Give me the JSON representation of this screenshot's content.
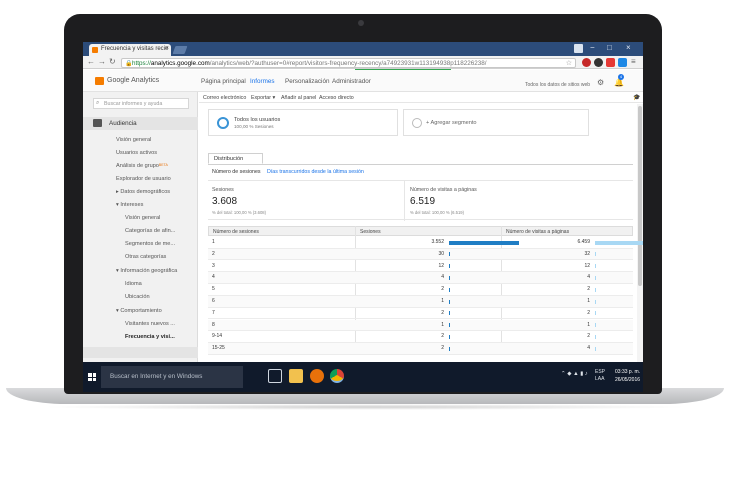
{
  "browser": {
    "tab_title": "Frecuencia y visitas recie",
    "tab_close": "×",
    "url_prefix": "https://",
    "url_host": "analytics.google.com",
    "url_path": "/analytics/web/?authuser=0#report/visitors-frequency-recency/a74923931w113194938p118226238/",
    "window_min": "−",
    "window_max": "□",
    "window_close": "×"
  },
  "ga": {
    "brand": "Google Analytics",
    "nav": [
      "Página principal",
      "Informes",
      "Personalización",
      "Administrador"
    ],
    "active_nav": "Informes",
    "account": "Todos los datos de sitios web"
  },
  "sidebar": {
    "search_placeholder": "Buscar informes y ayuda",
    "section": "Audiencia",
    "items": {
      "vision": "Visión general",
      "activos": "Usuarios activos",
      "grupo": "Análisis de grupo",
      "grupo_badge": "BETA",
      "explorador": "Explorador de usuario",
      "demograficos": "▸ Datos demográficos",
      "intereses": "▾ Intereses",
      "int_vision": "Visión general",
      "categorias": "Categorías de afin...",
      "segmentos": "Segmentos de me...",
      "otras": "Otras categorías",
      "geo": "▾ Información geográfica",
      "idioma": "Idioma",
      "ubicacion": "Ubicación",
      "comportamiento": "▾ Comportamiento",
      "nuevos": "Visitantes nuevos ...",
      "frecuencia": "Frecuencia y visi..."
    }
  },
  "toolbar": {
    "email": "Correo electrónico",
    "export": "Exportar ▾",
    "add_panel": "Añadir al panel",
    "shortcut": "Acceso directo"
  },
  "segment": {
    "name": "Todos los usuarios",
    "sub": "100,00 % Sesiones",
    "add": "+ Agregar segmento"
  },
  "tabs": {
    "distribution": "Distribución",
    "sub_active": "Número de sesiones",
    "sub_other": "Días transcurridos desde la última sesión"
  },
  "metrics": {
    "sessions_label": "Sesiones",
    "sessions_value": "3.608",
    "sessions_sub": "% del total: 100,00 % (3.608)",
    "pageviews_label": "Número de visitas a páginas",
    "pageviews_value": "6.519",
    "pageviews_sub": "% del total: 100,00 % (6.519)"
  },
  "table": {
    "headers": [
      "Número de sesiones",
      "Sesiones",
      "Número de visitas a páginas"
    ],
    "rows": [
      {
        "count": "1",
        "sessions": "3.552",
        "sessions_n": 3552,
        "pageviews": "6.459",
        "pageviews_n": 6459
      },
      {
        "count": "2",
        "sessions": "30",
        "sessions_n": 30,
        "pageviews": "32",
        "pageviews_n": 32
      },
      {
        "count": "3",
        "sessions": "12",
        "sessions_n": 12,
        "pageviews": "12",
        "pageviews_n": 12
      },
      {
        "count": "4",
        "sessions": "4",
        "sessions_n": 4,
        "pageviews": "4",
        "pageviews_n": 4
      },
      {
        "count": "5",
        "sessions": "2",
        "sessions_n": 2,
        "pageviews": "2",
        "pageviews_n": 2
      },
      {
        "count": "6",
        "sessions": "1",
        "sessions_n": 1,
        "pageviews": "1",
        "pageviews_n": 1
      },
      {
        "count": "7",
        "sessions": "2",
        "sessions_n": 2,
        "pageviews": "2",
        "pageviews_n": 2
      },
      {
        "count": "8",
        "sessions": "1",
        "sessions_n": 1,
        "pageviews": "1",
        "pageviews_n": 1
      },
      {
        "count": "9-14",
        "sessions": "2",
        "sessions_n": 2,
        "pageviews": "2",
        "pageviews_n": 2
      },
      {
        "count": "15-25",
        "sessions": "2",
        "sessions_n": 2,
        "pageviews": "4",
        "pageviews_n": 4
      }
    ]
  },
  "taskbar": {
    "search": "Buscar en Internet y en Windows",
    "lang": "ESP",
    "region": "LAA",
    "time": "03:33 p. m.",
    "date": "26/05/2016"
  },
  "colors": {
    "accent": "#1a73e8",
    "sessions_bar": "#1f7dc4",
    "pageviews_bar": "#a8d8f4",
    "ga_orange": "#f57c00"
  }
}
